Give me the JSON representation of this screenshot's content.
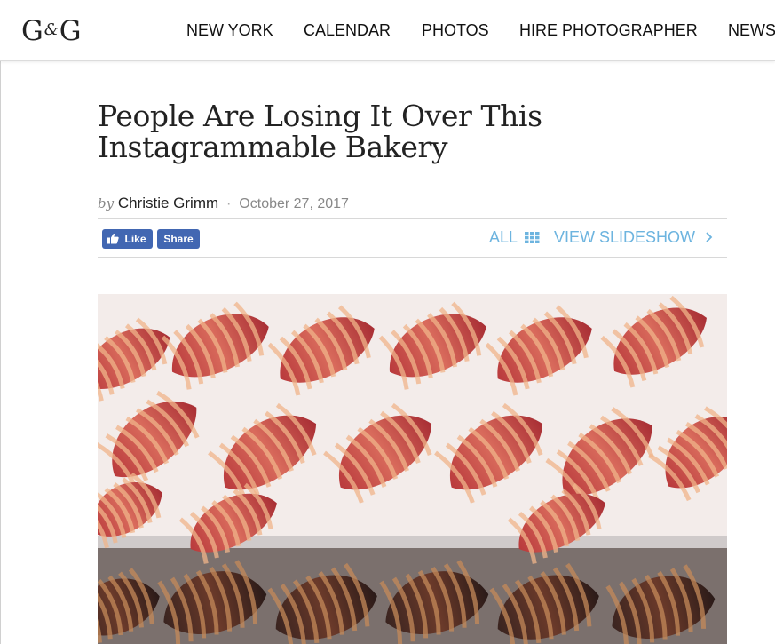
{
  "header": {
    "logo": {
      "left": "G",
      "amp": "&",
      "right": "G"
    },
    "nav": [
      "NEW YORK",
      "CALENDAR",
      "PHOTOS",
      "HIRE PHOTOGRAPHER",
      "NEWS"
    ]
  },
  "article": {
    "title": "People Are Losing It Over This Instagrammable Bakery",
    "by_prefix": "by",
    "author": "Christie Grimm",
    "separator": "·",
    "date": "October 27, 2017"
  },
  "share": {
    "like_label": "Like",
    "share_label": "Share"
  },
  "actions": {
    "all_label": "ALL",
    "slideshow_label": "VIEW SLIDESHOW"
  },
  "colors": {
    "accent": "#6db4df",
    "facebook": "#4267b2"
  },
  "icons": {
    "grid": "grid-icon",
    "chevron": "chevron-right-icon",
    "thumb": "thumbs-up-icon"
  }
}
